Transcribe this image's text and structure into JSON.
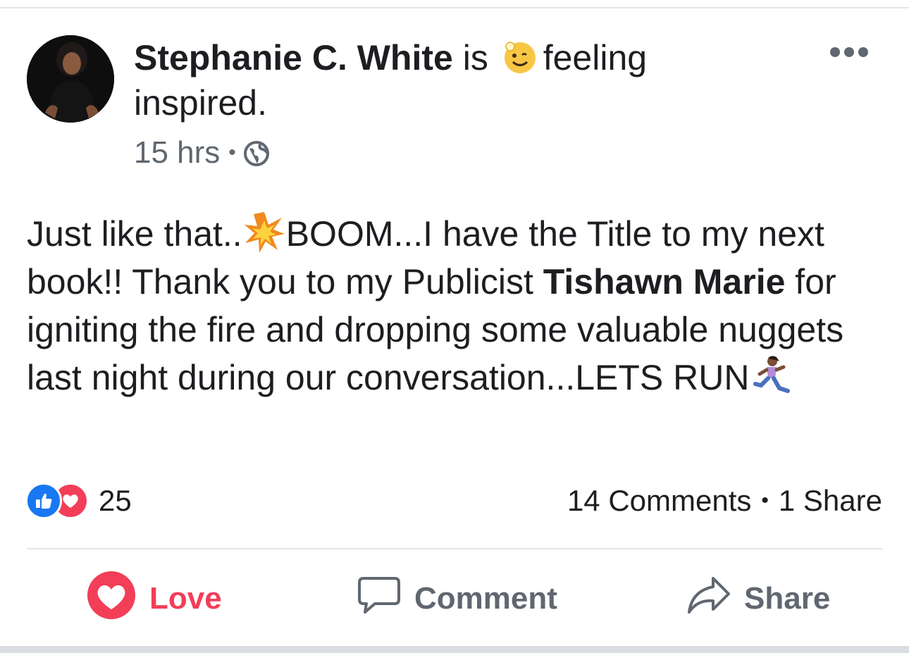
{
  "post": {
    "author": "Stephanie C. White",
    "header_is": "is",
    "feeling_prefix": "feeling",
    "feeling_word": "inspired.",
    "feeling_emoji": "inspired-face-emoji",
    "time": "15 hrs",
    "audience_icon": "globe-icon",
    "body": {
      "part1": "Just like that..",
      "emoji_boom": "collision-emoji",
      "part2": "BOOM...I have the Title to my next book!! Thank you to my Publicist ",
      "mention": "Tishawn Marie",
      "part3": " for igniting the fire and dropping some valuable nuggets last night during our conversation...LETS RUN",
      "emoji_run": "woman-running-emoji"
    }
  },
  "reactions": {
    "icons": [
      "like-icon",
      "love-icon"
    ],
    "count": "25"
  },
  "engagement": {
    "comments": "14 Comments",
    "separator": "•",
    "shares": "1 Share"
  },
  "actions": {
    "love_label": "Love",
    "comment_label": "Comment",
    "share_label": "Share"
  },
  "colors": {
    "love_red": "#f33e58",
    "like_blue": "#1877f2",
    "muted_text": "#606770",
    "text": "#1c1e21"
  }
}
